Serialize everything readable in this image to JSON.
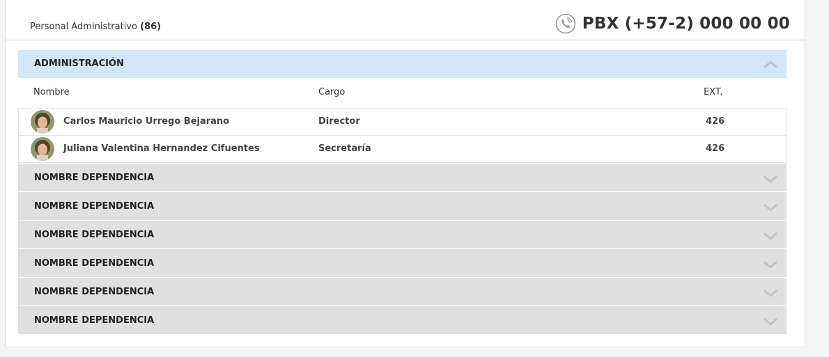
{
  "header": {
    "staff_label": "Personal Administrativo",
    "staff_count": "(86)",
    "pbx_icon": "phone-icon",
    "pbx_text": "PBX (+57-2) 000 00 00"
  },
  "expanded_section": {
    "title": "ADMINISTRACIÓN",
    "toggle_icon": "chevron-up-icon",
    "columns": {
      "name": "Nombre",
      "position": "Cargo",
      "ext": "EXT."
    },
    "rows": [
      {
        "name": "Carlos Mauricio Urrego Bejarano",
        "position": "Director",
        "ext": "426"
      },
      {
        "name": "Juliana Valentina Hernandez Cifuentes",
        "position": "Secretaría",
        "ext": "426"
      }
    ]
  },
  "collapsed_sections": [
    {
      "title": "NOMBRE DEPENDENCIA",
      "toggle_icon": "chevron-down-icon"
    },
    {
      "title": "NOMBRE DEPENDENCIA",
      "toggle_icon": "chevron-down-icon"
    },
    {
      "title": "NOMBRE DEPENDENCIA",
      "toggle_icon": "chevron-down-icon"
    },
    {
      "title": "NOMBRE DEPENDENCIA",
      "toggle_icon": "chevron-down-icon"
    },
    {
      "title": "NOMBRE DEPENDENCIA",
      "toggle_icon": "chevron-down-icon"
    },
    {
      "title": "NOMBRE DEPENDENCIA",
      "toggle_icon": "chevron-down-icon"
    }
  ],
  "colors": {
    "expanded_header_bg": "#d3e7fb",
    "collapsed_header_bg": "#e0e0e0",
    "chevron": "#c4c4c4"
  }
}
